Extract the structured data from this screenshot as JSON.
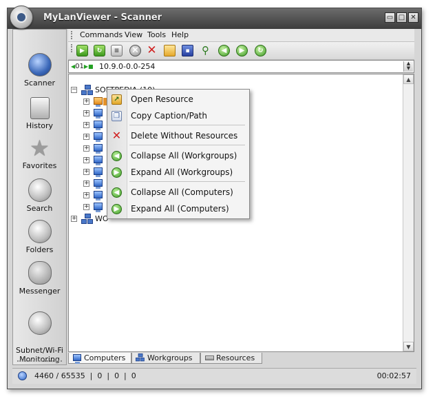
{
  "window": {
    "title": "MyLanViewer - Scanner",
    "controls": [
      "▭",
      "□",
      "✕"
    ]
  },
  "sidebar": {
    "items": [
      {
        "label": "Scanner",
        "icon": "globe-icon"
      },
      {
        "label": "History",
        "icon": "history-icon"
      },
      {
        "label": "Favorites",
        "icon": "star-icon"
      },
      {
        "label": "Search",
        "icon": "search-icon"
      },
      {
        "label": "Folders",
        "icon": "folders-icon"
      },
      {
        "label": "Messenger",
        "icon": "messenger-icon"
      },
      {
        "label": "Subnet/Wi-Fi\nMonitoring",
        "icon": "monitoring-icon"
      }
    ]
  },
  "menubar": {
    "items": [
      "Commands",
      "View",
      "Tools",
      "Help"
    ]
  },
  "toolbar": {
    "buttons": [
      "start-scan-icon",
      "refresh-icon",
      "scan-list-icon",
      "stop-icon",
      "delete-icon",
      "open-folder-icon",
      "save-icon",
      "find-icon",
      "back-icon",
      "forward-icon",
      "reload-icon"
    ]
  },
  "address": {
    "indicator": "01",
    "range": "10.9.0-0.0-254"
  },
  "tree": {
    "root": {
      "label": "SOFTPEDIA (10)"
    },
    "second_root": {
      "label": "WO"
    }
  },
  "context_menu": {
    "items": [
      {
        "label": "Open Resource",
        "icon": "open-resource-icon"
      },
      {
        "label": "Copy Caption/Path",
        "icon": "copy-icon"
      },
      {
        "label": "Delete Without Resources",
        "icon": "delete-icon"
      },
      {
        "label": "Collapse All (Workgroups)",
        "icon": "collapse-icon"
      },
      {
        "label": "Expand All (Workgroups)",
        "icon": "expand-icon"
      },
      {
        "label": "Collapse All (Computers)",
        "icon": "collapse-icon"
      },
      {
        "label": "Expand All (Computers)",
        "icon": "expand-icon"
      }
    ]
  },
  "tabs": [
    {
      "label": "Computers",
      "icon": "computer-icon"
    },
    {
      "label": "Workgroups",
      "icon": "workgroup-icon"
    },
    {
      "label": "Resources",
      "icon": "resources-icon"
    }
  ],
  "status": {
    "text": "4460 / 65535  |  0  |  0  |  0",
    "time": "00:02:57"
  }
}
